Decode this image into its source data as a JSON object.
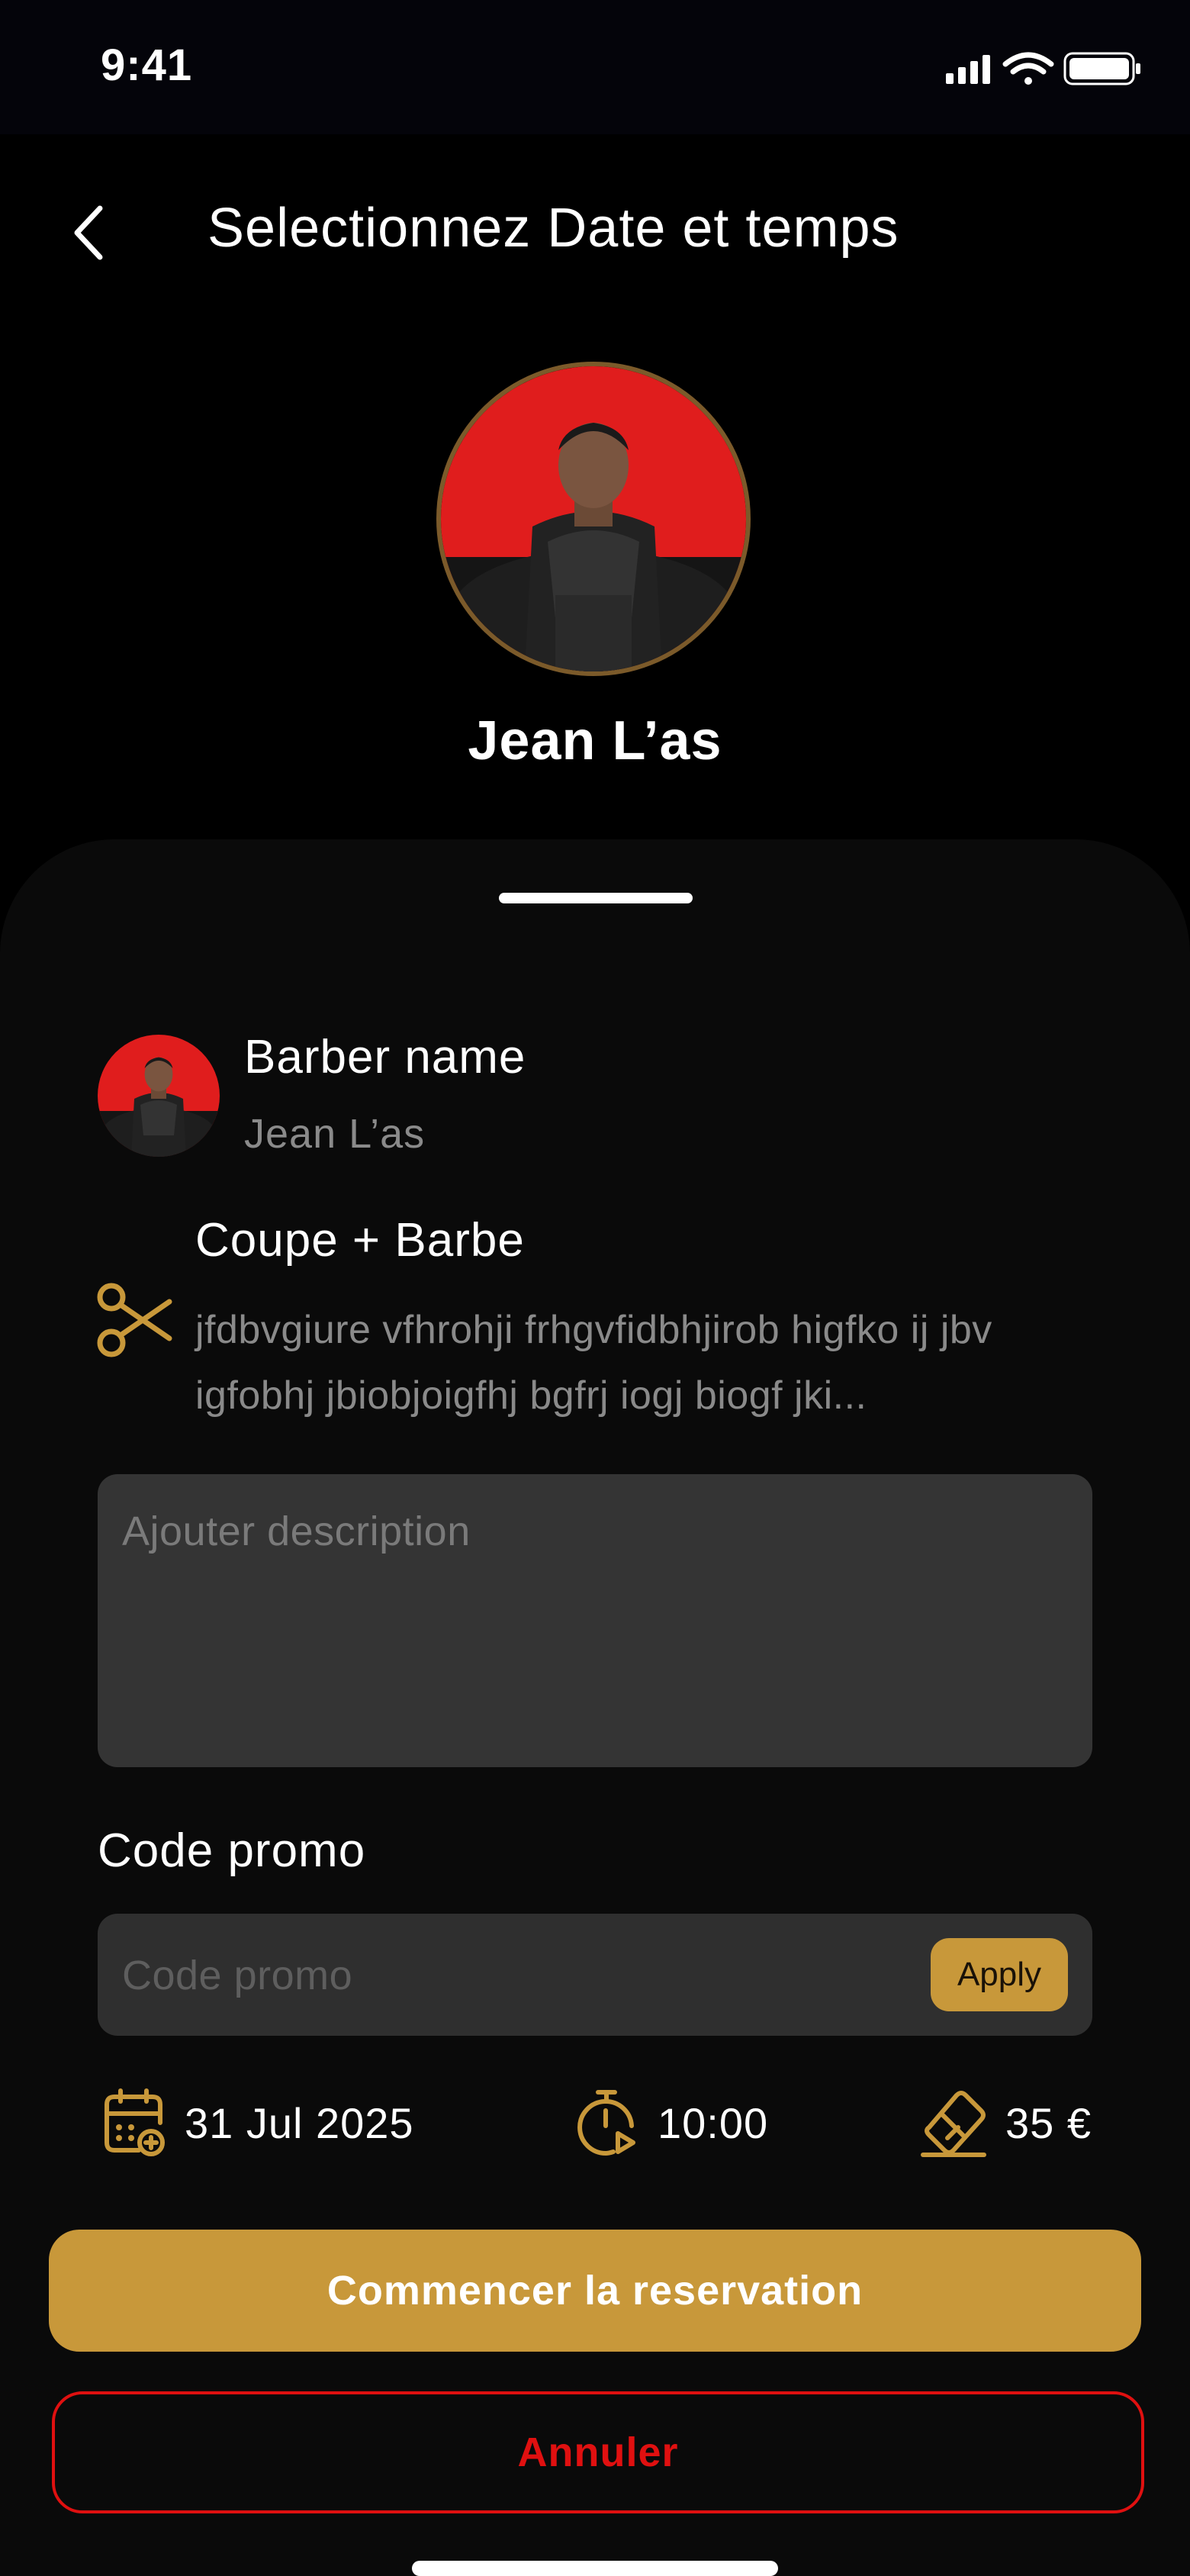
{
  "status_bar": {
    "time": "9:41"
  },
  "header": {
    "title": "Selectionnez Date et temps"
  },
  "barber": {
    "name": "Jean L’as"
  },
  "details": {
    "barber_label": "Barber name",
    "barber_value": "Jean L’as",
    "service_title": "Coupe + Barbe",
    "service_description": "jfdbvgiure vfhrohji frhgvfidbhjirob higfko ij jbv igfobhj jbiobjoigfhj bgfrj iogj biogf jki..."
  },
  "description_input": {
    "placeholder": "Ajouter description"
  },
  "promo": {
    "label": "Code promo",
    "placeholder": "Code promo",
    "apply_label": "Apply"
  },
  "summary": {
    "date": "31 Jul 2025",
    "time": "10:00",
    "price": "35 €"
  },
  "actions": {
    "start_label": "Commencer la reservation",
    "cancel_label": "Annuler"
  },
  "colors": {
    "accent": "#c8983a",
    "danger": "#e01010",
    "background": "#000000",
    "sheet": "#0a0a0a",
    "input": "#343434"
  },
  "icons": [
    "back-icon",
    "scissors-icon",
    "calendar-icon",
    "timer-icon",
    "ticket-icon",
    "signal-icon",
    "wifi-icon",
    "battery-icon"
  ]
}
